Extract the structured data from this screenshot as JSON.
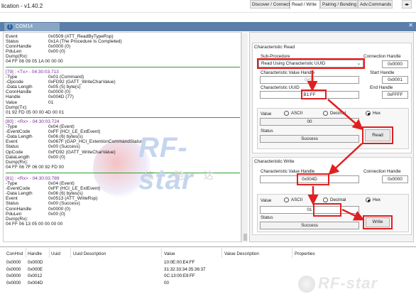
{
  "window": {
    "title": "lication - v1.40.2",
    "min": "—",
    "max": "☐",
    "close": "✕"
  },
  "tab": {
    "label": "COM14"
  },
  "log": {
    "block1": [
      [
        "Event",
        "0x0509 (ATT_ReadByTypeRsp)"
      ],
      [
        "Status",
        "0x1A (The Procedure Is Completed)"
      ],
      [
        "ConnHandle",
        "0x0000 (0)"
      ],
      [
        "PduLen",
        "0x00 (0)"
      ],
      [
        "Dump(Rx):",
        ""
      ],
      [
        "04 FF 06 09 05 1A 00 00 00",
        ""
      ]
    ],
    "block2": [
      [
        "[79] : <Tx> - 04:30:03.713",
        ""
      ],
      [
        "-Type",
        "0x01 (Command)"
      ],
      [
        "-Opcode",
        "0xFD92 (GATT_WriteCharValue)"
      ],
      [
        "-Data Length",
        "0x05 (5) byte(s)"
      ],
      [
        "ConnHandle",
        "0x0000 (0)"
      ],
      [
        "Handle",
        "0x004D (77)"
      ],
      [
        "Value",
        "01"
      ],
      [
        "Dump(Tx):",
        ""
      ],
      [
        "01 92 FD 05 00 00 4D 00 01",
        ""
      ]
    ],
    "block3": [
      [
        "[80] : <Rx> - 04:30:03.724",
        ""
      ],
      [
        "-Type",
        "0x04 (Event)"
      ],
      [
        "-EventCode",
        "0xFF (HCI_LE_ExtEvent)"
      ],
      [
        "-Data Length",
        "0x06 (6) bytes(s)"
      ],
      [
        "Event",
        "0x067F (GAP_HCI_ExtentionCommandStatus)"
      ],
      [
        "Status",
        "0x00 (Success)"
      ],
      [
        "OpCode",
        "0xFD92 (GATT_WriteCharValue)"
      ],
      [
        "DataLength",
        "0x00 (0)"
      ],
      [
        "Dump(Rx):",
        ""
      ],
      [
        "04 FF 06 7F 06 00 92 FD 00",
        ""
      ]
    ],
    "block4": [
      [
        "[81] : <Rx> - 04:30:03.789",
        ""
      ],
      [
        "-Type",
        "0x04 (Event)"
      ],
      [
        "-EventCode",
        "0xFF (HCI_LE_ExtEvent)"
      ],
      [
        "-Data Length",
        "0x06 (6) bytes(s)"
      ],
      [
        "Event",
        "0x0513 (ATT_WriteRsp)"
      ],
      [
        "Status",
        "0x00 (Success)"
      ],
      [
        "ConnHandle",
        "0x0000 (0)"
      ],
      [
        "PduLen",
        "0x00 (0)"
      ],
      [
        "Dump(Rx):",
        ""
      ],
      [
        "04 FF 06 13 05 00 00 00 00",
        ""
      ]
    ]
  },
  "watermark": {
    "text": "RF-star",
    "cn": "信 驰 达"
  },
  "panel": {
    "tabs": [
      "Discover / Connect",
      "Read / Write",
      "Pairing / Bonding",
      "Adv.Commands"
    ],
    "read": {
      "title": "Characteristic Read",
      "sub_procedure_label": "Sub-Procedure",
      "sub_procedure_value": "Read Using Characteristic UUID",
      "conn_handle_label": "Connection Handle",
      "conn_handle_value": "0x0000",
      "value_handle_label": "Characteristic Value Handle",
      "value_handle_value": "0x00",
      "start_handle_label": "Start Handle",
      "start_handle_value": "0x0001",
      "uuid_label": "Characteristic UUID",
      "uuid_value": "B1:FF",
      "end_handle_label": "End Handle",
      "end_handle_value": "0xFFFF",
      "value_label": "Value",
      "ascii": "ASCII",
      "decimal": "Decimal",
      "hex": "Hex",
      "value": "00",
      "status_label": "Status",
      "status_value": "Success",
      "read_button": "Read"
    },
    "write": {
      "title": "Characteristic Write",
      "value_handle_label": "Characteristic Value Handle",
      "value_handle_value": "0x004D",
      "conn_handle_label": "Connection Handle",
      "conn_handle_value": "0x0000",
      "value_label": "Value",
      "ascii": "ASCII",
      "decimal": "Decimal",
      "hex": "Hex",
      "value": "01",
      "status_label": "Status",
      "status_value": "Success",
      "write_button": "Write"
    }
  },
  "table": {
    "headers": [
      "ConHnd",
      "Handle",
      "Uuid",
      "Uuid Description",
      "Value",
      "Value Description",
      "Properties"
    ],
    "rows": [
      [
        "0x0000",
        "0x000D",
        "",
        "",
        "10:0E:00:E4:FF",
        "",
        ""
      ],
      [
        "0x0000",
        "0x000E",
        "",
        "",
        "31:32:33:34:35:36:37",
        "",
        ""
      ],
      [
        "0x0000",
        "0x0012",
        "",
        "",
        "0C:13:00:E9:FF",
        "",
        ""
      ],
      [
        "0x0000",
        "0x004D",
        "",
        "",
        "00",
        "",
        ""
      ]
    ]
  },
  "logo": {
    "text": "RF-star"
  },
  "colors": {
    "accent": "#5b7fa8",
    "highlight": "#e02020",
    "separator": "#2fa02f"
  }
}
